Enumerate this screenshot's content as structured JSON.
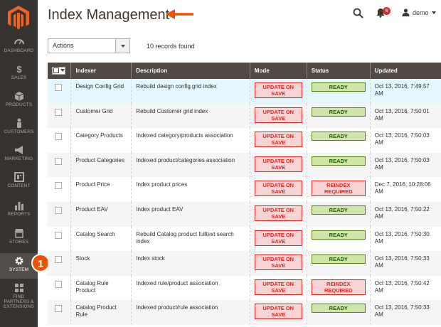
{
  "sidebar": {
    "items": [
      {
        "label": "DASHBOARD",
        "icon": "dashboard-icon"
      },
      {
        "label": "SALES",
        "icon": "dollar-icon"
      },
      {
        "label": "PRODUCTS",
        "icon": "cube-icon"
      },
      {
        "label": "CUSTOMERS",
        "icon": "person-icon"
      },
      {
        "label": "MARKETING",
        "icon": "megaphone-icon"
      },
      {
        "label": "CONTENT",
        "icon": "layout-icon"
      },
      {
        "label": "REPORTS",
        "icon": "bar-chart-icon"
      },
      {
        "label": "STORES",
        "icon": "storefront-icon"
      },
      {
        "label": "SYSTEM",
        "icon": "gear-icon"
      },
      {
        "label": "FIND PARTNERS & EXTENSIONS",
        "icon": "puzzle-icon"
      }
    ],
    "step_badge": "1"
  },
  "header": {
    "title": "Index Management",
    "notifications_count": "5",
    "user": "demo"
  },
  "toolbar": {
    "actions_label": "Actions",
    "records_found": "10 records found"
  },
  "table": {
    "columns": [
      "Indexer",
      "Description",
      "Mode",
      "Status",
      "Updated"
    ],
    "rows": [
      {
        "indexer": "Design Config Grid",
        "description": "Rebuild design config grid index",
        "mode": "UPDATE ON SAVE",
        "status": "READY",
        "updated": "Oct 13, 2016, 7:49:57 AM"
      },
      {
        "indexer": "Customer Grid",
        "description": "Rebuild Customer grid index",
        "mode": "UPDATE ON SAVE",
        "status": "READY",
        "updated": "Oct 13, 2016, 7:50:01 AM"
      },
      {
        "indexer": "Category Products",
        "description": "Indexed category/products association",
        "mode": "UPDATE ON SAVE",
        "status": "READY",
        "updated": "Oct 13, 2016, 7:50:03 AM"
      },
      {
        "indexer": "Product Categories",
        "description": "Indexed product/categories association",
        "mode": "UPDATE ON SAVE",
        "status": "READY",
        "updated": "Oct 13, 2016, 7:50:03 AM"
      },
      {
        "indexer": "Product Price",
        "description": "Index product prices",
        "mode": "UPDATE ON SAVE",
        "status": "REINDEX REQUIRED",
        "updated": "Dec 7, 2016, 10:28:06 AM"
      },
      {
        "indexer": "Product EAV",
        "description": "Index product EAV",
        "mode": "UPDATE ON SAVE",
        "status": "READY",
        "updated": "Oct 13, 2016, 7:50:22 AM"
      },
      {
        "indexer": "Catalog Search",
        "description": "Rebuild Catalog product fulltext search index",
        "mode": "UPDATE ON SAVE",
        "status": "READY",
        "updated": "Oct 13, 2016, 7:50:30 AM"
      },
      {
        "indexer": "Stock",
        "description": "Index stock",
        "mode": "UPDATE ON SAVE",
        "status": "READY",
        "updated": "Oct 13, 2016, 7:50:33 AM"
      },
      {
        "indexer": "Catalog Rule Product",
        "description": "Indexed rule/product association",
        "mode": "UPDATE ON SAVE",
        "status": "REINDEX REQUIRED",
        "updated": "Oct 13, 2016, 7:50:42 AM"
      },
      {
        "indexer": "Catalog Product Rule",
        "description": "Indexed product/rule association",
        "mode": "UPDATE ON SAVE",
        "status": "READY",
        "updated": "Oct 13, 2016, 7:50:33 AM"
      }
    ]
  }
}
